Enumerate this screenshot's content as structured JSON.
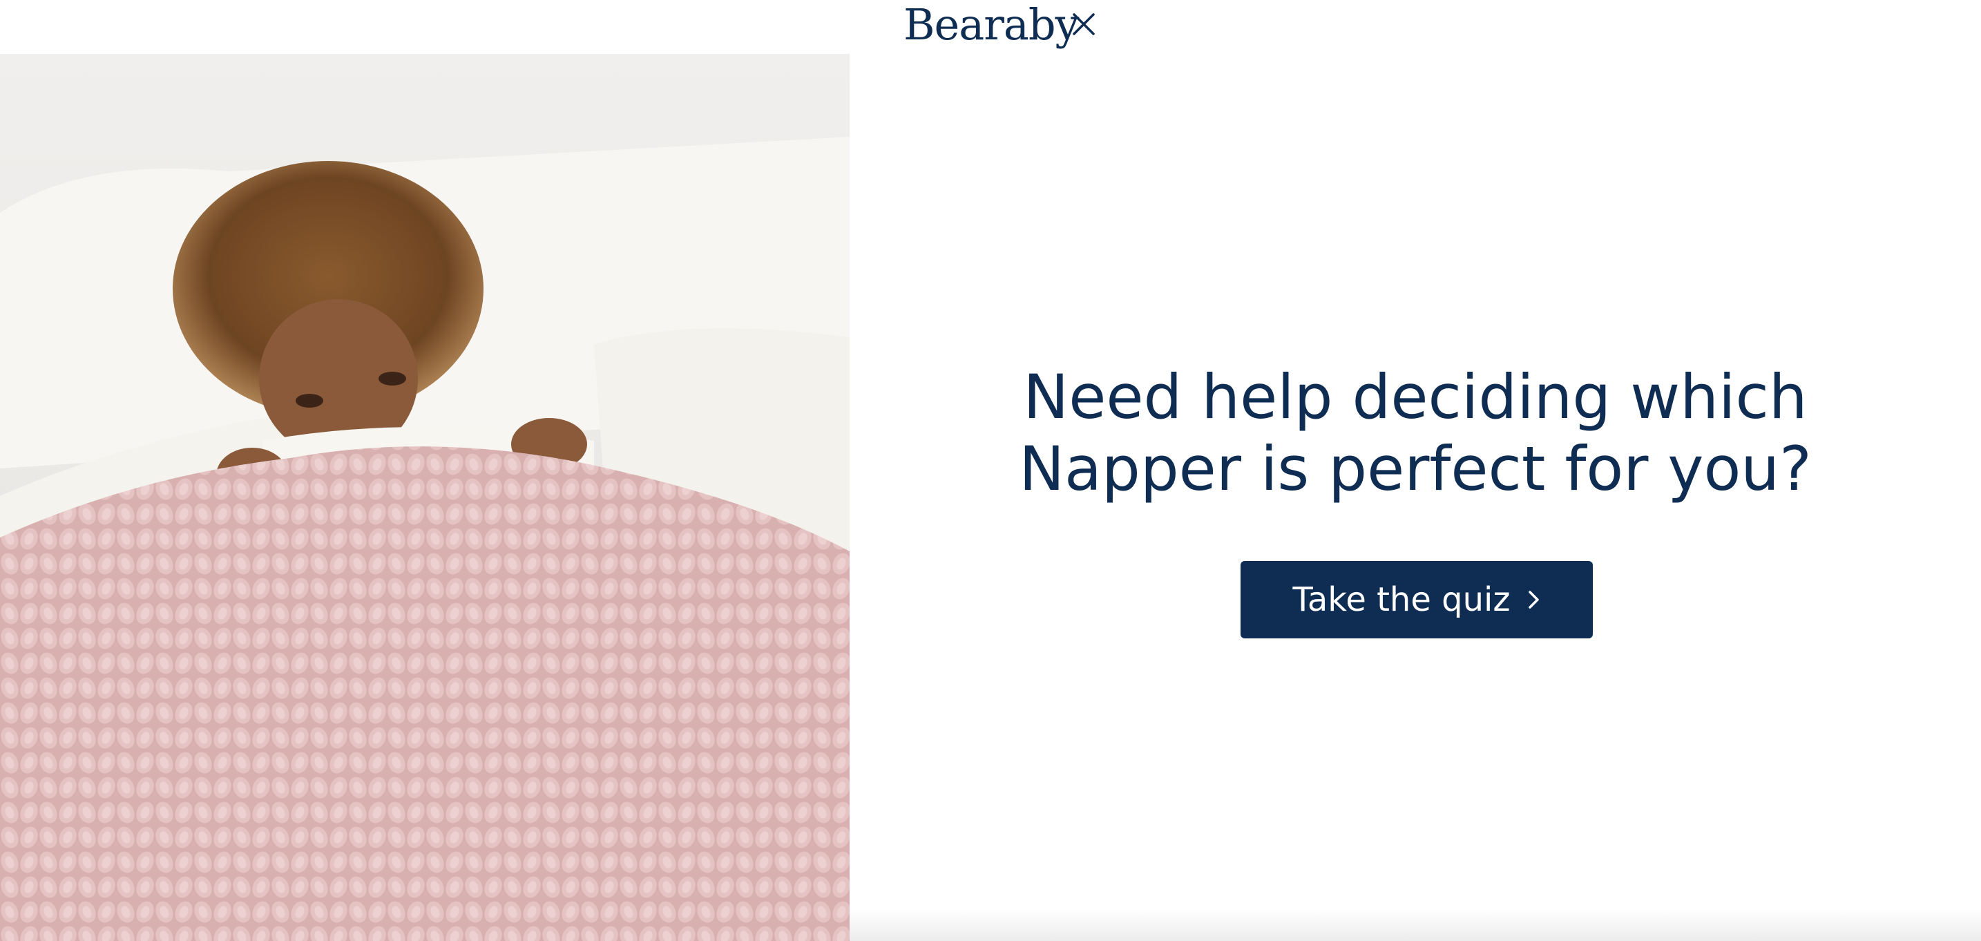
{
  "brand": {
    "logo_text": "Bearaby"
  },
  "header": {
    "close_icon": "close-icon"
  },
  "hero": {
    "icon": "photo-woman-under-knit-blanket",
    "colors": {
      "blanket": "#d9b2b2",
      "pillow": "#f4f2ee",
      "background": "#eeeeee"
    }
  },
  "main": {
    "headline_line1": "Need help deciding which",
    "headline_line2": "Napper is perfect for you?",
    "cta_label": "Take the quiz",
    "cta_icon": "chevron-right-icon"
  },
  "colors": {
    "navy": "#0f2c52",
    "white": "#ffffff"
  }
}
